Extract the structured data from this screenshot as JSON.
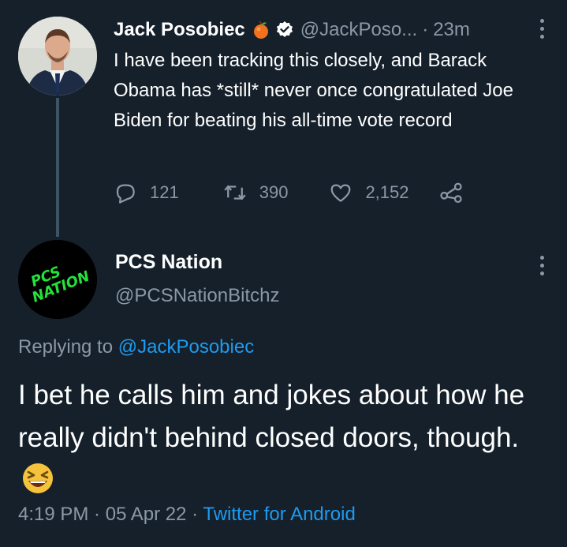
{
  "tweet": {
    "display_name": "Jack Posobiec",
    "handle": "@JackPoso...",
    "separator": "·",
    "time": "23m",
    "text": "I have been tracking this closely, and Barack Obama has *still* never once congratulated Joe Biden for beating his all-time vote record",
    "replies": "121",
    "retweets": "390",
    "likes": "2,152"
  },
  "reply": {
    "display_name": "PCS Nation",
    "handle": "@PCSNationBitchz",
    "avatar_text": "PCS NATION",
    "replying_prefix": "Replying to ",
    "replying_to": "@JackPosobiec",
    "text": "I bet he calls him and jokes about how he really didn't behind closed doors, though.",
    "time": "4:19 PM",
    "date": "05 Apr 22",
    "sep1": " · ",
    "sep2": " · ",
    "source": "Twitter for Android"
  },
  "colors": {
    "background": "#15202b",
    "muted": "#8b98a5",
    "link": "#1d9bf0",
    "avatar_text": "#22e33a"
  },
  "icons": [
    "apple-emoji-icon",
    "verified-icon",
    "more-icon",
    "reply-icon",
    "retweet-icon",
    "like-icon",
    "share-icon",
    "laughing-emoji-icon"
  ]
}
